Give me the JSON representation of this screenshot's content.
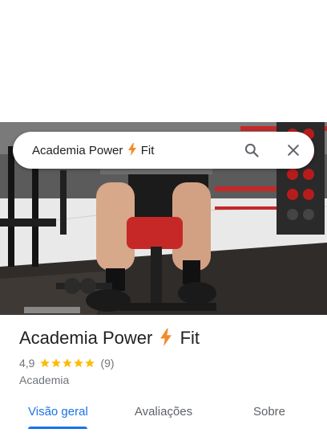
{
  "search": {
    "query_part1": "Academia Power",
    "query_part2": "Fit",
    "search_icon": "search-icon",
    "close_icon": "close-icon"
  },
  "place": {
    "name_part1": "Academia Power",
    "name_part2": "Fit",
    "rating": "4,9",
    "stars": 5,
    "review_count": "(9)",
    "category": "Academia",
    "bolt_color": "#f28b2b",
    "star_color": "#fbbc04"
  },
  "tabs": [
    {
      "label": "Visão geral",
      "active": true
    },
    {
      "label": "Avaliações",
      "active": false
    },
    {
      "label": "Sobre",
      "active": false
    }
  ],
  "accent_color": "#1a73e8"
}
